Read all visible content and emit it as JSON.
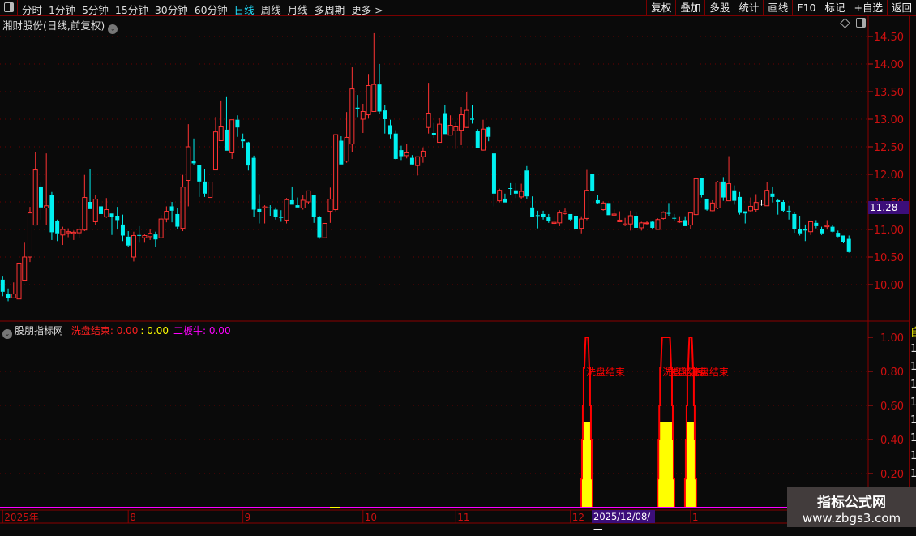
{
  "toolbar": {
    "periods": [
      "分时",
      "1分钟",
      "5分钟",
      "15分钟",
      "30分钟",
      "60分钟",
      "日线",
      "周线",
      "月线",
      "多周期",
      "更多 >"
    ],
    "active_period": "日线",
    "right_buttons": [
      "复权",
      "叠加",
      "多股",
      "统计",
      "画线",
      "F10",
      "标记",
      "+自选",
      "返回"
    ]
  },
  "main": {
    "title": "湘财股份(日线,前复权)",
    "current_price": "11.28"
  },
  "indicator": {
    "name": "股朋指标网",
    "fields": [
      {
        "label": "洗盘结束:",
        "value": "0.00",
        "color": "#ff2020"
      },
      {
        "label": ":",
        "value": "0.00",
        "color": "#ffff00"
      },
      {
        "label": "二板牛:",
        "value": "0.00",
        "color": "#ff00ff"
      }
    ],
    "signal_label": "洗盘结束",
    "axis_ticks": [
      "1.00",
      "0.80",
      "0.60",
      "0.40",
      "0.20"
    ],
    "events": [
      {
        "bars": [
          107
        ],
        "peak": 1.0,
        "fill": 0.5
      },
      {
        "bars": [
          121,
          122
        ],
        "peak": 1.0,
        "fill": 0.5
      },
      {
        "bars": [
          126
        ],
        "peak": 1.0,
        "fill": 0.5
      }
    ]
  },
  "date_axis": {
    "labels": [
      {
        "text": "2025年",
        "bar": 0
      },
      {
        "text": "8",
        "bar": 23
      },
      {
        "text": "9",
        "bar": 44
      },
      {
        "text": "10",
        "bar": 66
      },
      {
        "text": "11",
        "bar": 83
      },
      {
        "text": "12",
        "bar": 104
      },
      {
        "text": "1",
        "bar": 126
      }
    ],
    "selected": "2025/12/08/一"
  },
  "side_strip": [
    "自",
    "1",
    "1",
    "1",
    "1",
    "1",
    "1",
    "1",
    "1"
  ],
  "watermark": {
    "line1": "指标公式网",
    "line2": "www.zbgs3.com"
  },
  "colors": {
    "up": "#ff3333",
    "down": "#00f0f0",
    "grid": "#6a0000",
    "axis": "#cc1010",
    "signal": "#ff0000",
    "fill": "#ffff00",
    "magenta": "#ff00ff"
  },
  "chart_data": {
    "type": "candlestick",
    "ylim": [
      9.6,
      14.7
    ],
    "y_ticks": [
      "14.50",
      "14.00",
      "13.50",
      "13.00",
      "12.50",
      "12.00",
      "11.50",
      "11.00",
      "10.50",
      "10.00"
    ],
    "ohlc": [
      [
        10.09,
        10.16,
        9.79,
        9.87
      ],
      [
        9.83,
        9.93,
        9.7,
        9.76
      ],
      [
        9.76,
        10.04,
        9.76,
        9.83
      ],
      [
        9.74,
        10.8,
        9.62,
        10.39
      ],
      [
        10.08,
        10.76,
        10.08,
        10.5
      ],
      [
        10.5,
        11.41,
        10.41,
        11.3
      ],
      [
        11.08,
        12.41,
        11.08,
        12.08
      ],
      [
        11.78,
        11.85,
        11.18,
        11.4
      ],
      [
        11.39,
        12.38,
        11.08,
        11.43
      ],
      [
        11.62,
        11.68,
        10.81,
        10.95
      ],
      [
        11.15,
        11.18,
        10.79,
        10.93
      ],
      [
        10.9,
        11.05,
        10.72,
        11.0
      ],
      [
        10.94,
        11.02,
        10.86,
        10.96
      ],
      [
        10.93,
        10.98,
        10.81,
        10.95
      ],
      [
        10.94,
        11.05,
        10.84,
        11.0
      ],
      [
        10.99,
        11.99,
        10.97,
        11.58
      ],
      [
        11.5,
        12.1,
        11.37,
        11.37
      ],
      [
        11.14,
        11.62,
        11.08,
        11.55
      ],
      [
        11.42,
        11.52,
        11.21,
        11.28
      ],
      [
        11.23,
        11.57,
        11.21,
        11.36
      ],
      [
        11.29,
        11.29,
        10.9,
        11.23
      ],
      [
        11.25,
        11.41,
        11.0,
        11.17
      ],
      [
        11.09,
        11.27,
        10.79,
        10.89
      ],
      [
        10.87,
        10.97,
        10.69,
        10.71
      ],
      [
        10.5,
        10.96,
        10.42,
        10.89
      ],
      [
        10.9,
        11.06,
        10.76,
        10.89
      ],
      [
        10.85,
        10.91,
        10.76,
        10.89
      ],
      [
        10.87,
        11.01,
        10.81,
        10.93
      ],
      [
        10.91,
        10.96,
        10.69,
        10.82
      ],
      [
        10.85,
        11.26,
        10.84,
        11.19
      ],
      [
        11.19,
        11.42,
        11.13,
        11.33
      ],
      [
        11.42,
        11.5,
        11.13,
        11.34
      ],
      [
        11.28,
        11.39,
        11.0,
        11.05
      ],
      [
        11.02,
        11.99,
        10.97,
        11.77
      ],
      [
        11.89,
        12.91,
        11.42,
        12.5
      ],
      [
        12.25,
        12.65,
        12.17,
        12.2
      ],
      [
        12.17,
        12.17,
        11.59,
        11.87
      ],
      [
        11.87,
        12.09,
        11.59,
        11.65
      ],
      [
        11.58,
        11.86,
        11.58,
        11.86
      ],
      [
        12.08,
        13.04,
        12.08,
        12.77
      ],
      [
        12.61,
        13.34,
        12.61,
        12.86
      ],
      [
        12.81,
        13.4,
        12.43,
        12.43
      ],
      [
        12.39,
        12.99,
        12.28,
        12.99
      ],
      [
        12.99,
        13.07,
        12.68,
        12.85
      ],
      [
        12.63,
        12.74,
        12.47,
        12.6
      ],
      [
        12.58,
        12.59,
        12.07,
        12.16
      ],
      [
        12.3,
        12.34,
        11.23,
        11.36
      ],
      [
        11.37,
        11.64,
        11.11,
        11.31
      ],
      [
        11.39,
        11.44,
        11.11,
        11.41
      ],
      [
        11.4,
        11.44,
        11.25,
        11.39
      ],
      [
        11.36,
        11.4,
        11.18,
        11.23
      ],
      [
        11.23,
        11.35,
        11.14,
        11.21
      ],
      [
        11.17,
        11.57,
        11.11,
        11.54
      ],
      [
        11.53,
        11.78,
        11.45,
        11.45
      ],
      [
        11.44,
        11.58,
        11.4,
        11.4
      ],
      [
        11.39,
        11.62,
        11.36,
        11.53
      ],
      [
        11.5,
        11.7,
        11.47,
        11.7
      ],
      [
        11.63,
        11.63,
        11.12,
        11.23
      ],
      [
        11.23,
        11.25,
        10.83,
        10.86
      ],
      [
        10.85,
        11.11,
        10.85,
        11.11
      ],
      [
        11.33,
        11.76,
        11.12,
        11.55
      ],
      [
        11.36,
        12.72,
        11.33,
        12.72
      ],
      [
        12.61,
        12.69,
        12.18,
        12.18
      ],
      [
        12.24,
        13.13,
        12.21,
        12.67
      ],
      [
        12.55,
        13.94,
        12.41,
        13.55
      ],
      [
        13.21,
        13.44,
        13.04,
        13.18
      ],
      [
        13.0,
        13.28,
        12.75,
        13.14
      ],
      [
        13.08,
        13.82,
        13.01,
        13.61
      ],
      [
        13.14,
        14.56,
        13.14,
        13.63
      ],
      [
        13.63,
        14.0,
        13.09,
        13.14
      ],
      [
        13.16,
        13.25,
        12.74,
        13.0
      ],
      [
        12.89,
        12.99,
        12.65,
        12.73
      ],
      [
        12.74,
        12.8,
        12.27,
        12.28
      ],
      [
        12.44,
        12.52,
        12.26,
        12.33
      ],
      [
        12.34,
        12.55,
        12.29,
        12.39
      ],
      [
        12.3,
        12.35,
        12.17,
        12.18
      ],
      [
        12.16,
        12.32,
        11.98,
        12.32
      ],
      [
        12.32,
        12.49,
        12.21,
        12.42
      ],
      [
        12.85,
        13.66,
        12.74,
        13.11
      ],
      [
        12.75,
        12.93,
        12.66,
        12.71
      ],
      [
        12.58,
        13.03,
        12.58,
        12.91
      ],
      [
        13.11,
        13.25,
        12.73,
        12.73
      ],
      [
        12.71,
        13.07,
        12.71,
        12.89
      ],
      [
        12.79,
        12.94,
        12.46,
        12.86
      ],
      [
        12.8,
        13.22,
        12.53,
        13.08
      ],
      [
        12.85,
        13.49,
        12.84,
        13.16
      ],
      [
        13.01,
        13.25,
        12.92,
        12.99
      ],
      [
        12.78,
        12.82,
        12.48,
        12.48
      ],
      [
        12.44,
        12.99,
        12.43,
        12.82
      ],
      [
        12.85,
        12.86,
        12.6,
        12.68
      ],
      [
        12.38,
        12.38,
        11.42,
        11.65
      ],
      [
        11.52,
        11.74,
        11.49,
        11.71
      ],
      [
        11.56,
        11.65,
        11.49,
        11.49
      ],
      [
        11.75,
        11.84,
        11.63,
        11.74
      ],
      [
        11.71,
        11.84,
        11.57,
        11.65
      ],
      [
        11.59,
        11.83,
        11.56,
        11.69
      ],
      [
        12.07,
        12.15,
        11.56,
        11.6
      ],
      [
        11.4,
        11.6,
        11.23,
        11.23
      ],
      [
        11.26,
        11.34,
        11.02,
        11.25
      ],
      [
        11.28,
        11.34,
        11.18,
        11.22
      ],
      [
        11.22,
        11.28,
        11.12,
        11.16
      ],
      [
        11.11,
        11.26,
        11.06,
        11.13
      ],
      [
        11.12,
        11.35,
        11.06,
        11.3
      ],
      [
        11.29,
        11.38,
        11.27,
        11.32
      ],
      [
        11.28,
        11.28,
        11.15,
        11.18
      ],
      [
        11.25,
        11.29,
        10.97,
        11.0
      ],
      [
        11.02,
        11.24,
        10.93,
        11.19
      ],
      [
        11.2,
        12.08,
        11.17,
        11.71
      ],
      [
        12.0,
        12.0,
        11.69,
        11.7
      ],
      [
        11.53,
        11.62,
        11.46,
        11.48
      ],
      [
        11.36,
        11.51,
        11.34,
        11.48
      ],
      [
        11.48,
        11.48,
        11.26,
        11.26
      ],
      [
        11.26,
        11.36,
        11.26,
        11.28
      ],
      [
        11.14,
        11.33,
        11.14,
        11.17
      ],
      [
        11.08,
        11.21,
        11.06,
        11.1
      ],
      [
        11.1,
        11.34,
        10.98,
        11.25
      ],
      [
        11.25,
        11.31,
        11.03,
        11.03
      ],
      [
        11.03,
        11.14,
        10.98,
        11.12
      ],
      [
        11.11,
        11.16,
        11.09,
        11.12
      ],
      [
        11.14,
        11.15,
        11.0,
        11.03
      ],
      [
        11.0,
        11.2,
        11.0,
        11.18
      ],
      [
        11.2,
        11.33,
        11.18,
        11.31
      ],
      [
        11.3,
        11.48,
        11.25,
        11.29
      ],
      [
        11.21,
        11.28,
        11.15,
        11.2
      ],
      [
        11.14,
        11.24,
        11.12,
        11.15
      ],
      [
        11.17,
        11.24,
        11.06,
        11.06
      ],
      [
        11.08,
        11.3,
        11.0,
        11.3
      ],
      [
        11.27,
        11.94,
        11.26,
        11.92
      ],
      [
        11.93,
        11.93,
        11.58,
        11.62
      ],
      [
        11.55,
        11.56,
        11.34,
        11.36
      ],
      [
        11.34,
        11.53,
        11.33,
        11.48
      ],
      [
        11.39,
        11.88,
        11.37,
        11.86
      ],
      [
        11.87,
        11.95,
        11.52,
        11.58
      ],
      [
        11.52,
        12.33,
        11.52,
        11.83
      ],
      [
        11.71,
        11.8,
        11.45,
        11.52
      ],
      [
        11.59,
        11.68,
        11.27,
        11.3
      ],
      [
        11.33,
        11.33,
        11.11,
        11.29
      ],
      [
        11.34,
        11.58,
        11.31,
        11.42
      ],
      [
        11.36,
        11.64,
        11.31,
        11.49
      ],
      [
        11.46,
        11.53,
        11.43,
        11.46
      ],
      [
        11.43,
        11.86,
        11.43,
        11.71
      ],
      [
        11.65,
        11.78,
        11.49,
        11.59
      ],
      [
        11.53,
        11.56,
        11.27,
        11.5
      ],
      [
        11.5,
        11.53,
        11.31,
        11.34
      ],
      [
        11.34,
        11.43,
        11.18,
        11.33
      ],
      [
        11.28,
        11.31,
        10.94,
        11.0
      ],
      [
        11.0,
        11.25,
        10.89,
        10.93
      ],
      [
        11.0,
        11.09,
        10.79,
        10.98
      ],
      [
        10.96,
        11.14,
        10.9,
        11.14
      ],
      [
        11.12,
        11.17,
        11.02,
        11.06
      ],
      [
        11.0,
        11.05,
        10.9,
        10.93
      ],
      [
        11.05,
        11.17,
        11.0,
        11.07
      ],
      [
        11.05,
        11.08,
        10.95,
        10.96
      ],
      [
        10.94,
        10.98,
        10.86,
        10.87
      ],
      [
        10.89,
        10.89,
        10.75,
        10.77
      ],
      [
        10.83,
        10.89,
        10.58,
        10.59
      ]
    ]
  }
}
